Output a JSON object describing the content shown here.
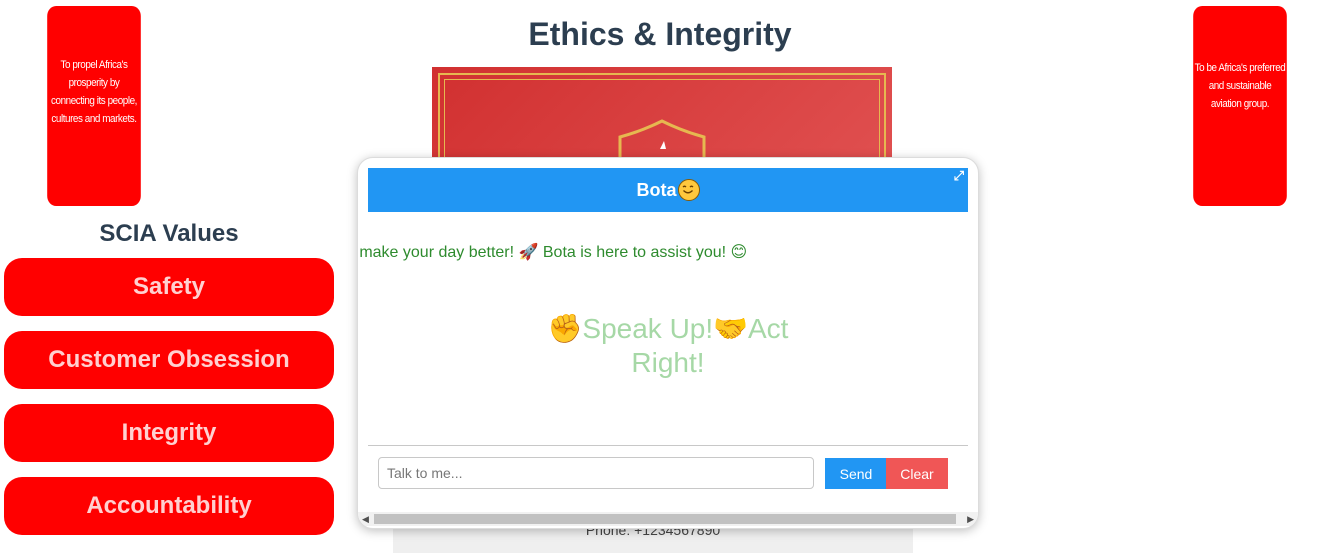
{
  "mission": "To propel Africa's prosperity by connecting its people, cultures and markets.",
  "vision": "To be Africa's preferred and sustainable aviation group.",
  "title": "Ethics & Integrity",
  "values_section": {
    "heading": "SCIA Values",
    "items": [
      "Safety",
      "Customer Obsession",
      "Integrity",
      "Accountability"
    ]
  },
  "footer": {
    "phone": "Phone: +1234567890"
  },
  "chat": {
    "header_title": "Bota",
    "welcome": "'s chat and make your day better! 🚀 Bota is here to assist you! 😊",
    "slogan": "✊Speak Up!🤝Act Right!",
    "input_placeholder": "Talk to me...",
    "send_label": "Send",
    "clear_label": "Clear"
  },
  "colors": {
    "brand_red": "#ff0000",
    "chat_blue": "#2196f3",
    "clear_red": "#f05656",
    "welcome_green": "#2e8b2e",
    "slogan_green": "#a6d8a6"
  },
  "icons": [
    "smile-emoji-icon",
    "expand-icon",
    "rocket-emoji-icon",
    "fist-emoji-icon",
    "handshake-emoji-icon",
    "shield-icon"
  ]
}
